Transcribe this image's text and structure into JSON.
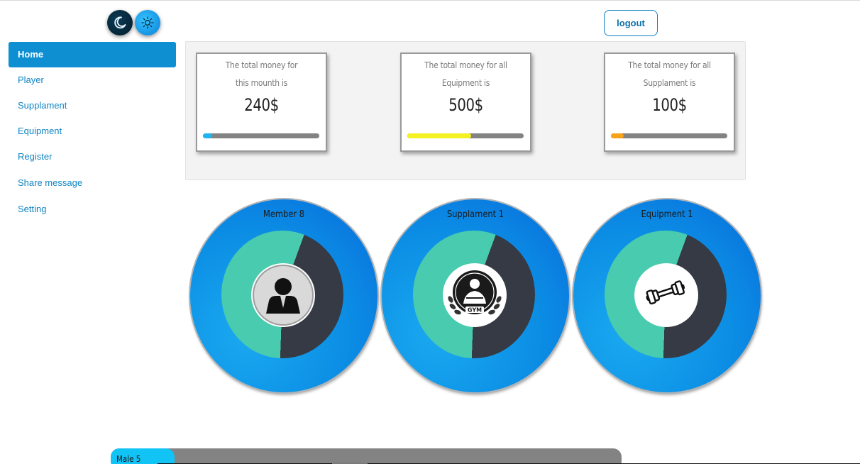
{
  "theme": {
    "dark_icon": "moon-icon",
    "light_icon": "sun-icon"
  },
  "header": {
    "logout_label": "logout"
  },
  "sidebar": {
    "items": [
      {
        "label": "Home",
        "active": true
      },
      {
        "label": "Player"
      },
      {
        "label": "Supplament"
      },
      {
        "label": "Equipment"
      },
      {
        "label": "Register"
      },
      {
        "label": "Share message"
      },
      {
        "label": "Setting"
      }
    ]
  },
  "money_cards": [
    {
      "line1": "The total money for",
      "line2": "this mounth is",
      "amount": "240$",
      "progress": 0.08,
      "color": "#1eb4f0"
    },
    {
      "line1": "The total money for all",
      "line2": "Equipment is",
      "amount": "500$",
      "progress": 0.55,
      "color": "#f4f222"
    },
    {
      "line1": "The total money for all",
      "line2": "Supplament is",
      "amount": "100$",
      "progress": 0.11,
      "color": "#f7a21a"
    }
  ],
  "stats": [
    {
      "title": "Member 8",
      "icon": "person-icon",
      "fraction": 0.55
    },
    {
      "title": "Supplament 1",
      "icon": "gym-logo-icon",
      "fraction": 0.55
    },
    {
      "title": "Equipment 1",
      "icon": "dumbbell-icon",
      "fraction": 0.55
    }
  ],
  "colors": {
    "primary": "#0d8fd2",
    "donut_filled": "#48cbae",
    "donut_empty": "#353a45"
  },
  "gender_bar": {
    "label": "Male 5",
    "progress": 0.125
  }
}
